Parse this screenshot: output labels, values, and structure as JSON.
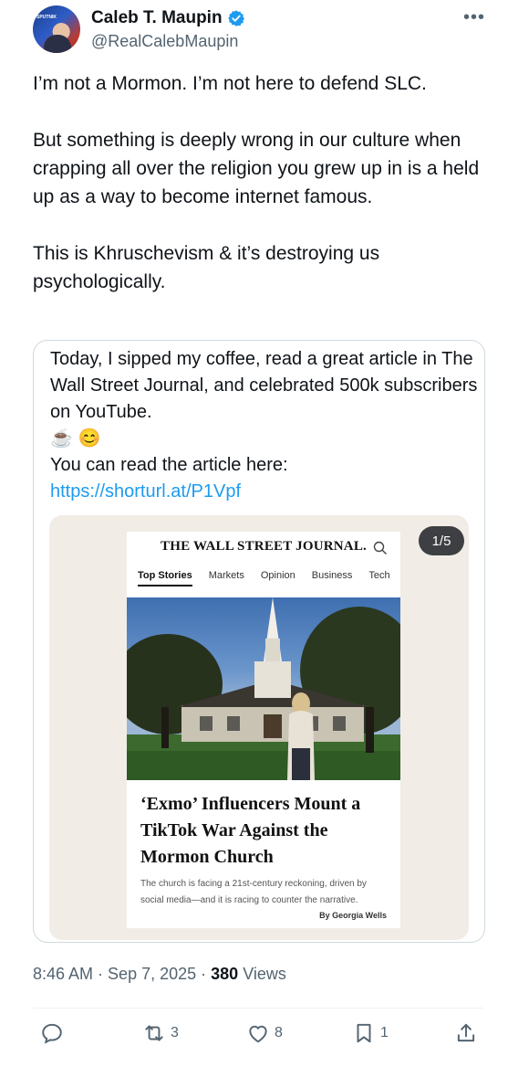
{
  "author": {
    "name": "Caleb T. Maupin",
    "handle": "@RealCalebMaupin",
    "verified": true,
    "avatar_tag": "SPUTNIK"
  },
  "more_icon": "more-horizontal-icon",
  "tweet_text": "I’m not a Mormon. I’m not here to defend SLC.\n\nBut something is deeply wrong in our culture when crapping all over the religion you grew up in is a held up as a way to become internet famous.\n\nThis is Khruschevism & it’s destroying us psychologically.",
  "quote": {
    "text": "Today, I sipped my coffee, read a great article in The Wall Street Journal, and celebrated 500k subscribers on YouTube.\n☕ 😊\nYou can read the article here: ",
    "link": "https://shorturl.at/P1Vpf",
    "media_counter": "1/5",
    "article": {
      "masthead": "THE WALL STREET JOURNAL.",
      "nav": [
        "Top Stories",
        "Markets",
        "Opinion",
        "Business",
        "Tech"
      ],
      "headline": "‘Exmo’ Influencers Mount a TikTok War Against the Mormon Church",
      "dek": "The church is facing a 21st-century reckoning, driven by social media—and it is racing to counter the narrative.",
      "byline": "By Georgia Wells"
    }
  },
  "meta": {
    "time": "8:46 AM",
    "date": "Sep 7, 2025",
    "views_count": "380",
    "views_label": "Views"
  },
  "actions": {
    "replies": "",
    "reposts": "3",
    "likes": "8",
    "bookmarks": "1"
  },
  "colors": {
    "accent": "#1d9bf0",
    "muted": "#536471",
    "text": "#0f1419"
  }
}
